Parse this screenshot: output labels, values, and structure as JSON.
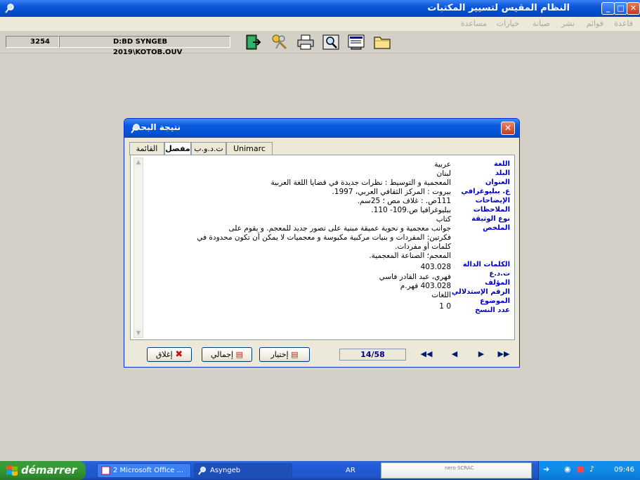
{
  "app": {
    "title": "النظام المقيس لتسيير المكتبات",
    "window_buttons": [
      "_",
      "□",
      "✕"
    ]
  },
  "menu": [
    "قاعدة",
    "قوائم",
    "نشر",
    "صيانة",
    "خيارات",
    "مساعدة"
  ],
  "toolbar": {
    "record_count": "3254",
    "db_path": "D:BD SYNGEB 2019\\KOTOB.OUV",
    "icons": [
      "exit-icon",
      "keys-icon",
      "printer-icon",
      "magnifier-icon",
      "screen-icon",
      "folder-icon"
    ]
  },
  "dialog": {
    "title": "نتيجة البحث",
    "tabs": [
      "القائمة",
      "مفصل",
      "ت.د.و.ب",
      "Unimarc"
    ],
    "active_tab": "مفصل",
    "labels": [
      "اللغة",
      "البلد",
      "العنوان",
      "ع. ببليوغرافي",
      "الإيضاحات",
      "الملاحظات",
      "نوع الوثيقة",
      "الملخص",
      "الكلمات الدالة",
      "ت.د.ع",
      "المؤلف",
      "الرقم الإستدلالي",
      "الموضوع",
      "عدد النسخ"
    ],
    "values": [
      "عربية",
      "لبنان",
      "المعجمية و التوسيط : نظرات جديدة في قضايا اللغة العربية",
      "بيروت : المركز الثقافي العربي، 1997.",
      "111ص. : غلاف مص ؛ 25سم.",
      "ببليوغرافيا ص.109- 110.",
      "كتاب",
      "جوانب معجمية و نحوية عميقة مبنية على تصور جديد للمعجم. و يقوم على",
      "فكرتين: المفردات و بنيات مركبية مكبوسة و معجميات لا يمكن أن تكون محدودة في",
      "كلمات أو مفردات.",
      "المعجم؛ الصناعة المعجمية.",
      "403.028",
      "فهري، عبد القادر فاسي",
      "403.028 فهر.م",
      "اللغات",
      "0 1"
    ],
    "buttons": {
      "close": "إغلاق",
      "summary": "إجمالي",
      "select": "إختيار"
    },
    "counter": "14/58",
    "nav": [
      "first",
      "previous",
      "next",
      "last"
    ]
  },
  "taskbar": {
    "start": "démarrer",
    "tasks": [
      "2 Microsoft Office ...",
      "Asyngeb"
    ],
    "lang": "AR",
    "nero": "nero\nSCRAC",
    "clock": "09:46"
  },
  "colors": {
    "label_blue": "#0000c0",
    "title_blue": "#0a57d8",
    "close_red": "#c63a1a"
  }
}
